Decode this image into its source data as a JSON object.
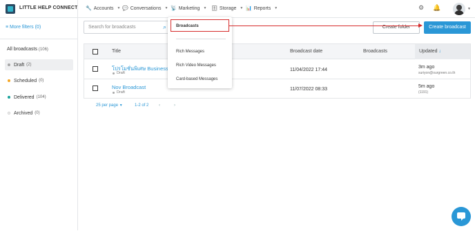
{
  "app": {
    "name": "LITTLE HELP CONNECT"
  },
  "nav": [
    {
      "label": "Accounts",
      "icon": "wrench-icon"
    },
    {
      "label": "Conversations",
      "icon": "chat-icon"
    },
    {
      "label": "Marketing",
      "icon": "antenna-icon"
    },
    {
      "label": "Storage",
      "icon": "folder-icon"
    },
    {
      "label": "Reports",
      "icon": "chart-icon"
    }
  ],
  "sidebar": {
    "more_filters": "More filters (0)",
    "all_label": "All broadcasts",
    "all_count": "(106)",
    "items": [
      {
        "label": "Draft",
        "count": "(2)",
        "color": "#a6a6a6",
        "active": true
      },
      {
        "label": "Scheduled",
        "count": "(0)",
        "color": "#f5a623"
      },
      {
        "label": "Delivered",
        "count": "(104)",
        "color": "#1ba39c"
      },
      {
        "label": "Archived",
        "count": "(0)",
        "color": "#d9d9d9"
      }
    ]
  },
  "search": {
    "placeholder": "Search for broadcasts"
  },
  "toolbar": {
    "create_folder": "Create folder",
    "create_broadcast": "Create broadcast"
  },
  "table": {
    "headers": {
      "title": "Title",
      "date": "Broadcast date",
      "broadcasts": "Broadcasts",
      "updated": "Updated"
    },
    "rows": [
      {
        "title": "โปรโมชั่นพิเศษ Business C",
        "status": "Draft",
        "date": "11/04/2022 17:44",
        "updated": "3m ago",
        "updated_by": "suriyon@ourgreen.co.th"
      },
      {
        "title": "Nov Broadcast",
        "status": "Draft",
        "date": "11/07/2022 08:33",
        "updated": "5m ago",
        "updated_by": "(1191)"
      }
    ]
  },
  "pager": {
    "per_page": "25 per page",
    "range": "1-2 of 2"
  },
  "marketing_menu": {
    "items": [
      "Broadcasts",
      "Rich Messages",
      "Rich Video Messages",
      "Card-based Messages"
    ]
  },
  "colors": {
    "accent": "#2a97d6",
    "annotation": "#d62b2b"
  }
}
